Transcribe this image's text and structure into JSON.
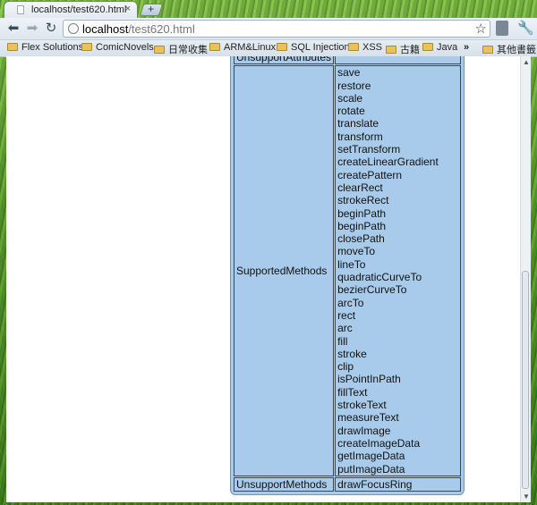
{
  "browser": {
    "tab_title": "localhost/test620.html",
    "tab_close": "×",
    "new_tab": "+",
    "url_host": "localhost",
    "url_path": "/test620.html",
    "star_icon": "☆",
    "wrench_icon": "🔧",
    "back": "⬅",
    "forward": "➡",
    "reload": "↻"
  },
  "bookmarks": {
    "items": [
      "Flex Solutions",
      "ComicNovels",
      "日常收集",
      "ARM&Linux",
      "SQL Injection",
      "XSS",
      "古籍",
      "Java"
    ],
    "chevron": "»",
    "other": "其他書籤"
  },
  "table": {
    "top_label": "UnsupportAttributes",
    "supported_label": "SupportedMethods",
    "supported_methods": [
      "save",
      "restore",
      "scale",
      "rotate",
      "translate",
      "transform",
      "setTransform",
      "createLinearGradient",
      "createPattern",
      "clearRect",
      "strokeRect",
      "beginPath",
      "beginPath",
      "closePath",
      "moveTo",
      "lineTo",
      "quadraticCurveTo",
      "bezierCurveTo",
      "arcTo",
      "rect",
      "arc",
      "fill",
      "stroke",
      "clip",
      "isPointInPath",
      "fillText",
      "strokeText",
      "measureText",
      "drawImage",
      "createImageData",
      "getImageData",
      "putImageData"
    ],
    "unsupported_label": "UnsupportMethods",
    "unsupported_value": "drawFocusRing"
  },
  "scrollbar": {
    "up": "▲",
    "down": "▼"
  }
}
